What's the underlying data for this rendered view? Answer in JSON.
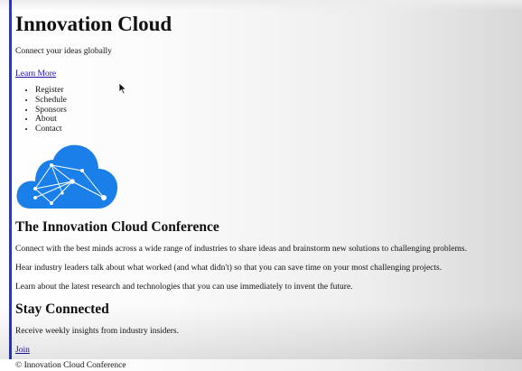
{
  "header": {
    "title": "Innovation Cloud",
    "tagline": "Connect your ideas globally",
    "learn_more": "Learn More"
  },
  "nav": {
    "items": [
      {
        "label": "Register"
      },
      {
        "label": "Schedule"
      },
      {
        "label": "Sponsors"
      },
      {
        "label": "About"
      },
      {
        "label": "Contact"
      }
    ]
  },
  "logo": {
    "icon": "cloud-network-icon",
    "color": "#1a7fe8"
  },
  "conference": {
    "heading": "The Innovation Cloud Conference",
    "paragraphs": [
      "Connect with the best minds across a wide range of industries to share ideas and brainstorm new solutions to challenging problems.",
      "Hear industry leaders talk about what worked (and what didn't) so that you can save time on your most challenging projects.",
      "Learn about the latest research and technologies that you can use immediately to invent the future."
    ]
  },
  "newsletter": {
    "heading": "Stay Connected",
    "text": "Receive weekly insights from industry insiders.",
    "join": "Join"
  },
  "footer": {
    "text": "© Innovation Cloud Conference"
  }
}
